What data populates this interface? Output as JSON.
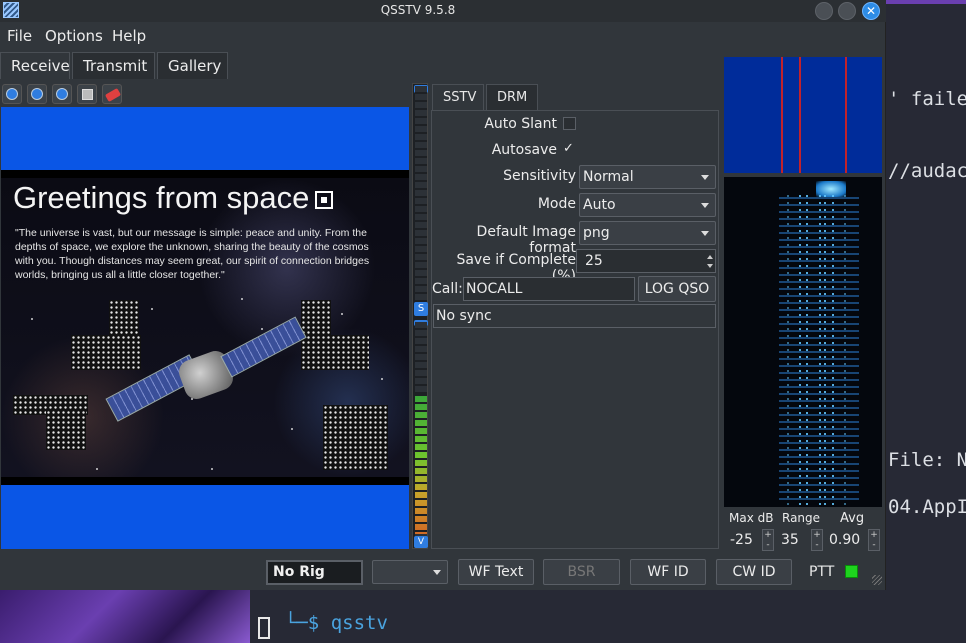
{
  "window": {
    "title": "QSSTV 9.5.8"
  },
  "menu": {
    "file": "File",
    "options": "Options",
    "help": "Help"
  },
  "tabs": {
    "receive": "Receive",
    "transmit": "Transmit",
    "gallery": "Gallery"
  },
  "toolbar": {
    "icons": [
      "play-icon",
      "stop-icon",
      "restart-icon",
      "save-icon",
      "erase-icon"
    ]
  },
  "image": {
    "title": "Greetings from space",
    "quote": "\"The universe is vast, but our message is simple: peace and unity. From the depths of space, we explore the unknown, sharing the beauty of the cosmos with you. Though distances may seem great, our spirit of connection bridges worlds, bringing us all a little closer together.\""
  },
  "sliders": {
    "sync_label": "S",
    "level_label": "V"
  },
  "mode_tabs": {
    "sstv": "SSTV",
    "drm": "DRM"
  },
  "settings": {
    "auto_slant_label": "Auto Slant",
    "auto_slant_checked": false,
    "autosave_label": "Autosave",
    "autosave_checked": true,
    "autosave_mark": "✓",
    "sensitivity_label": "Sensitivity",
    "sensitivity_value": "Normal",
    "mode_label": "Mode",
    "mode_value": "Auto",
    "image_format_label": "Default Image format",
    "image_format_value": "png",
    "save_complete_label": "Save if Complete (%)",
    "save_complete_value": "25",
    "call_label": "Call:",
    "call_value": "NOCALL",
    "log_qso": "LOG QSO",
    "sync_status": "No sync"
  },
  "waterfall": {
    "max_db_label": "Max dB",
    "range_label": "Range",
    "avg_label": "Avg",
    "max_db_value": "-25",
    "range_value": "35",
    "avg_value": "0.90",
    "plus": "+",
    "minus": "-"
  },
  "statusbar": {
    "rig": "No Rig",
    "wf_text": "WF Text",
    "bsr": "BSR",
    "wf_id": "WF ID",
    "cw_id": "CW ID",
    "ptt": "PTT",
    "ptt_color": "#1ed31e"
  },
  "terminal": {
    "line1": "' faile",
    "line2": "//audac",
    "line3": "File: N",
    "line4": "04.AppI",
    "prompt_branch": "└─",
    "prompt_dollar": "$",
    "prompt_cmd": "qsstv"
  },
  "colors": {
    "accent": "#2f7de0",
    "image_border": "#0a56e6",
    "spectrum_bg": "#002c9a",
    "marker": "#c2222a"
  }
}
